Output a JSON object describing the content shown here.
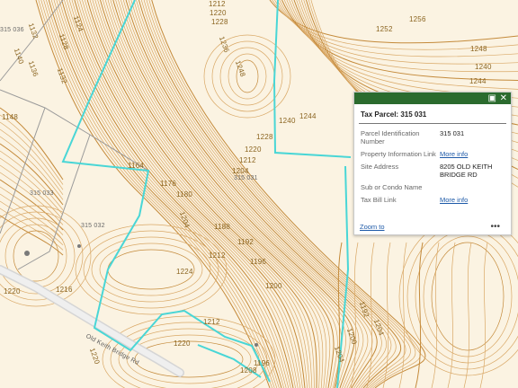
{
  "colors": {
    "background": "#fbf3e2",
    "contour": "#d9a866",
    "contour_index": "#c48a3a",
    "parcel_line": "#9a9a9a",
    "highlight_boundary": "#49d6d6",
    "popup_header": "#2b6b2e",
    "link": "#1e5aa8"
  },
  "map": {
    "contour_labels": [
      "1212",
      "1220",
      "1228",
      "1256",
      "1252",
      "1248",
      "1240",
      "1244",
      "1236",
      "1248",
      "1132",
      "1140",
      "1136",
      "1128",
      "1124",
      "1132",
      "1148",
      "1240",
      "1244",
      "1228",
      "1220",
      "1212",
      "1204",
      "1164",
      "1176",
      "1180",
      "1204",
      "1188",
      "1192",
      "1196",
      "1200",
      "1224",
      "1212",
      "1220",
      "1216",
      "1212",
      "1220",
      "1208",
      "1204",
      "1200",
      "1192",
      "1204",
      "1220",
      "1196"
    ],
    "parcel_labels": [
      "315 036",
      "315 033",
      "315 032",
      "315 031"
    ],
    "road_label": "Old Keith Bridge Rd"
  },
  "popup": {
    "header_icons": [
      "maximize-icon",
      "close-icon"
    ],
    "title": "Tax Parcel: 315 031",
    "rows": [
      {
        "key": "Parcel Identification Number",
        "value": "315 031"
      },
      {
        "key": "Property Information Link",
        "value": "More info"
      },
      {
        "key": "Site Address",
        "value": "8205 OLD KEITH BRIDGE RD"
      },
      {
        "key": "Sub or Condo Name",
        "value": ""
      },
      {
        "key": "Tax Bill Link",
        "value": "More info"
      }
    ],
    "zoom_label": "Zoom to",
    "more_label": "•••"
  }
}
